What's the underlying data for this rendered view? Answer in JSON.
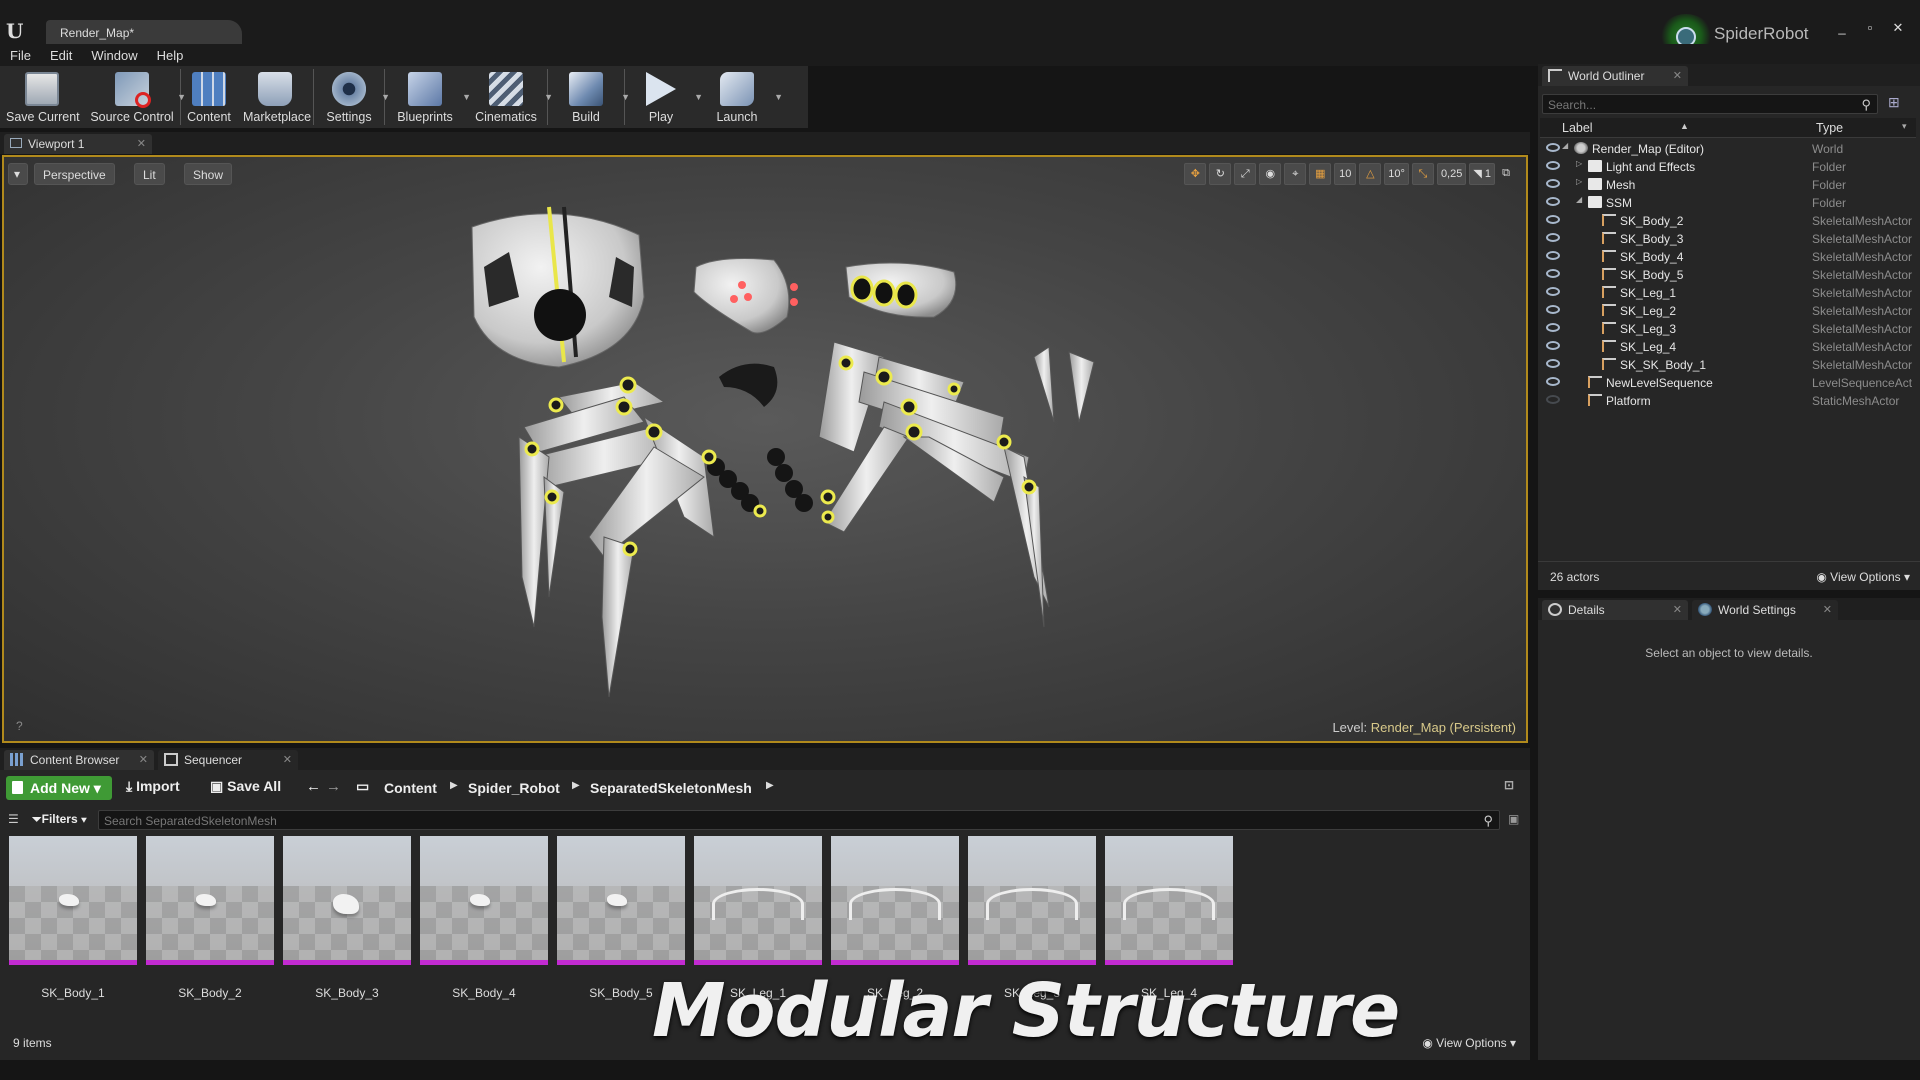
{
  "window": {
    "doc_tab": "Render_Map*",
    "project_name": "SpiderRobot",
    "controls": [
      "_",
      "▫",
      "✕"
    ]
  },
  "menu": [
    "File",
    "Edit",
    "Window",
    "Help"
  ],
  "toolbar": [
    {
      "label": "Save Current",
      "icon": "save-icon"
    },
    {
      "label": "Source Control",
      "icon": "source-control-icon"
    },
    {
      "label": "Content",
      "icon": "content-icon"
    },
    {
      "label": "Marketplace",
      "icon": "marketplace-icon"
    },
    {
      "label": "Settings",
      "icon": "settings-icon"
    },
    {
      "label": "Blueprints",
      "icon": "blueprints-icon"
    },
    {
      "label": "Cinematics",
      "icon": "cinematics-icon"
    },
    {
      "label": "Build",
      "icon": "build-icon"
    },
    {
      "label": "Play",
      "icon": "play-icon"
    },
    {
      "label": "Launch",
      "icon": "launch-icon"
    }
  ],
  "viewport": {
    "tab": "Viewport 1",
    "perspective": "Perspective",
    "lit": "Lit",
    "show": "Show",
    "grid_snap": "10",
    "rot_snap": "10°",
    "scale_snap": "0,25",
    "cam_speed": "1",
    "level_prefix": "Level:",
    "level_name": "Render_Map (Persistent)",
    "accent": "#b18a1c"
  },
  "outliner": {
    "tab": "World Outliner",
    "search_placeholder": "Search...",
    "col_label": "Label",
    "col_type": "Type",
    "rows": [
      {
        "name": "Render_Map (Editor)",
        "type": "World",
        "indent": 0,
        "expand": "open"
      },
      {
        "name": "Light and Effects",
        "type": "Folder",
        "indent": 1,
        "expand": "closed"
      },
      {
        "name": "Mesh",
        "type": "Folder",
        "indent": 1,
        "expand": "closed"
      },
      {
        "name": "SSM",
        "type": "Folder",
        "indent": 1,
        "expand": "open"
      },
      {
        "name": "SK_Body_2",
        "type": "SkeletalMeshActor",
        "indent": 2,
        "expand": ""
      },
      {
        "name": "SK_Body_3",
        "type": "SkeletalMeshActor",
        "indent": 2,
        "expand": ""
      },
      {
        "name": "SK_Body_4",
        "type": "SkeletalMeshActor",
        "indent": 2,
        "expand": ""
      },
      {
        "name": "SK_Body_5",
        "type": "SkeletalMeshActor",
        "indent": 2,
        "expand": ""
      },
      {
        "name": "SK_Leg_1",
        "type": "SkeletalMeshActor",
        "indent": 2,
        "expand": ""
      },
      {
        "name": "SK_Leg_2",
        "type": "SkeletalMeshActor",
        "indent": 2,
        "expand": ""
      },
      {
        "name": "SK_Leg_3",
        "type": "SkeletalMeshActor",
        "indent": 2,
        "expand": ""
      },
      {
        "name": "SK_Leg_4",
        "type": "SkeletalMeshActor",
        "indent": 2,
        "expand": ""
      },
      {
        "name": "SK_SK_Body_1",
        "type": "SkeletalMeshActor",
        "indent": 2,
        "expand": ""
      },
      {
        "name": "NewLevelSequence",
        "type": "LevelSequenceActor",
        "indent": 1,
        "expand": ""
      },
      {
        "name": "Platform",
        "type": "StaticMeshActor",
        "indent": 1,
        "expand": ""
      }
    ],
    "actor_count": "26 actors",
    "view_options": "View Options"
  },
  "details": {
    "tab": "Details",
    "tab2": "World Settings",
    "message": "Select an object to view details."
  },
  "content_browser": {
    "tab": "Content Browser",
    "tab2": "Sequencer",
    "add_new": "Add New",
    "import": "Import",
    "save_all": "Save All",
    "breadcrumbs": [
      "Content",
      "Spider_Robot",
      "SeparatedSkeletonMesh"
    ],
    "filters": "Filters",
    "search_placeholder": "Search SeparatedSkeletonMesh",
    "assets": [
      "SK_Body_1",
      "SK_Body_2",
      "SK_Body_3",
      "SK_Body_4",
      "SK_Body_5",
      "SK_Leg_1",
      "SK_Leg_2",
      "SK_Leg_3",
      "SK_Leg_4"
    ],
    "item_count": "9 items",
    "view_options": "View Options",
    "asset_bar_color": "#c22bd1"
  },
  "overlay_title": "Modular Structure"
}
